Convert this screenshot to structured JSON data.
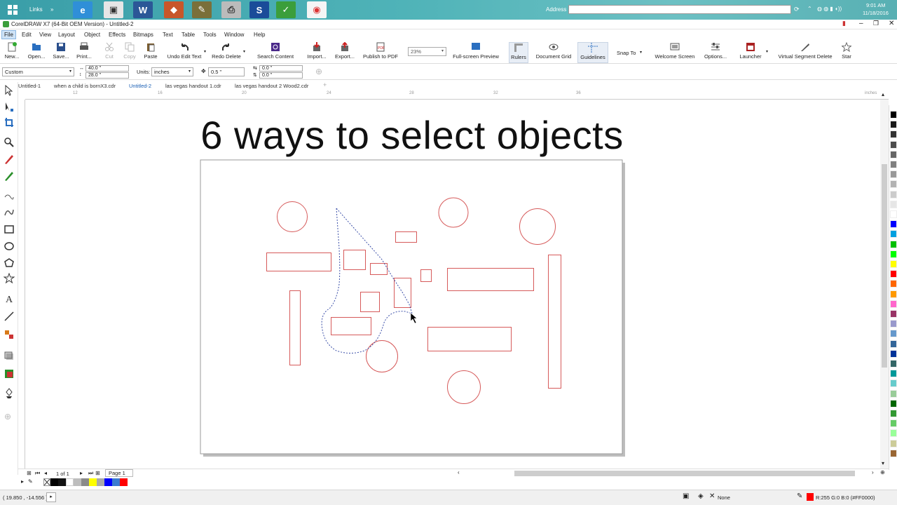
{
  "taskbar": {
    "links_label": "Links",
    "address_label": "Address",
    "clock_time": "9:01 AM",
    "clock_date": "11/18/2016"
  },
  "window": {
    "title": "CorelDRAW X7 (64-Bit OEM Version) - Untitled-2"
  },
  "menu": [
    "File",
    "Edit",
    "View",
    "Layout",
    "Object",
    "Effects",
    "Bitmaps",
    "Text",
    "Table",
    "Tools",
    "Window",
    "Help"
  ],
  "toolbar": {
    "new": "New...",
    "open": "Open...",
    "save": "Save...",
    "print": "Print...",
    "cut": "Cut",
    "copy": "Copy",
    "paste": "Paste",
    "undo": "Undo Edit Text",
    "redo": "Redo Delete",
    "search": "Search Content",
    "import": "Import...",
    "export": "Export...",
    "publish": "Publish to PDF",
    "zoom": "23%",
    "fullscreen": "Full-screen Preview",
    "rulers": "Rulers",
    "docgrid": "Document Grid",
    "guidelines": "Guidelines",
    "snapto": "Snap To",
    "welcome": "Welcome Screen",
    "options": "Options...",
    "launcher": "Launcher",
    "vsd": "Virtual Segment Delete",
    "star": "Star"
  },
  "propbar": {
    "page_preset": "Custom",
    "width": "40.0 \"",
    "height": "28.0 \"",
    "units_label": "Units:",
    "units": "inches",
    "nudge": "0.5 \"",
    "dup_x": "0.0 \"",
    "dup_y": "0.0 \""
  },
  "doc_tabs": [
    "Untitled-1",
    "when a child is bornX3.cdr",
    "Untitled-2",
    "las vegas handout 1.cdr",
    "las vegas handout 2 Wood2.cdr"
  ],
  "ruler": {
    "ticks": [
      "12",
      "16",
      "20",
      "24",
      "28",
      "32",
      "36"
    ],
    "unit": "inches"
  },
  "canvas": {
    "title": "6 ways to select objects"
  },
  "pager": {
    "count": "1 of 1",
    "page_tab": "Page 1"
  },
  "status": {
    "coords": "( 19.850 , -14.556 )",
    "fill_none": "None",
    "outline_color": "R:255 G:0 B:0 (#FF0000)"
  },
  "colors": {
    "shape_outline": "#d65a5a",
    "marquee": "#3a4ea8",
    "accent": "#0078d7"
  }
}
